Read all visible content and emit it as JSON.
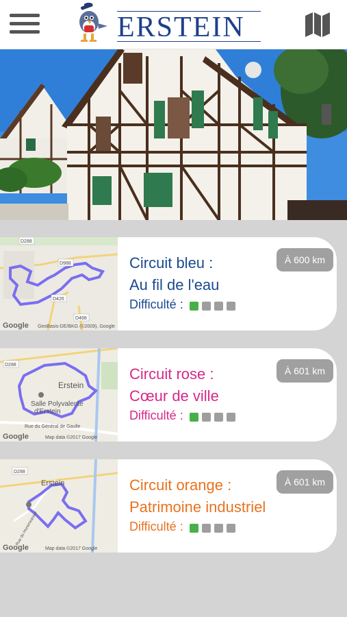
{
  "header": {
    "logo_text": "ERSTEIN",
    "menu_icon": "hamburger-menu-icon",
    "map_icon": "folded-map-icon"
  },
  "circuits": [
    {
      "line1": "Circuit bleu :",
      "line2": "Au fil de l'eau",
      "color": "#1a4a8e",
      "difficulty_label": "Difficulté :",
      "difficulty_level": 1,
      "difficulty_max": 4,
      "distance": "À 600 km",
      "map_labels": [
        "D288",
        "D988",
        "D426",
        "D468"
      ],
      "map_credit": "GeoBasis-DE/BKG (©2009), Google"
    },
    {
      "line1": "Circuit rose :",
      "line2": "Cœur de ville",
      "color": "#d6288a",
      "difficulty_label": "Difficulté :",
      "difficulty_level": 1,
      "difficulty_max": 4,
      "distance": "À 601 km",
      "map_labels": [
        "D288",
        "Erstein",
        "Salle Polyvalente",
        "d'Erstein",
        "Rue du Général de Gaulle"
      ],
      "map_credit": "Map data ©2017 Google"
    },
    {
      "line1": "Circuit orange :",
      "line2": "Patrimoine industriel",
      "color": "#e8721f",
      "difficulty_label": "Difficulté :",
      "difficulty_level": 1,
      "difficulty_max": 4,
      "distance": "À 601 km",
      "map_labels": [
        "D288",
        "Erstein",
        "Rue du Hunerwasser"
      ],
      "map_credit": "Map data ©2017 Google"
    }
  ],
  "colors": {
    "route": "#7a6ef0",
    "difficulty_on": "#48b048",
    "difficulty_off": "#9e9e9e",
    "brand": "#1e3f8c"
  }
}
